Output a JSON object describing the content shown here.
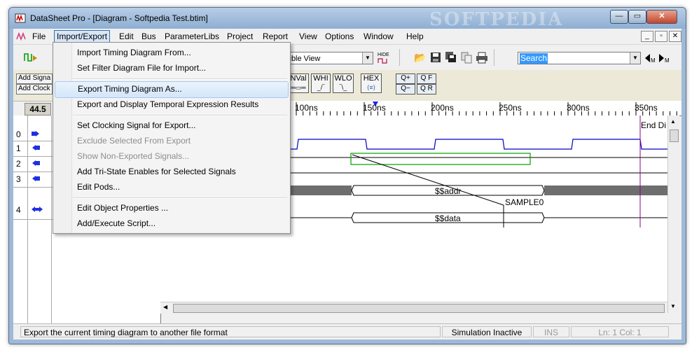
{
  "window": {
    "title": "DataSheet Pro - [Diagram - Softpedia Test.btim]",
    "watermark": "SOFTPEDIA",
    "controls": {
      "minimize": "—",
      "maximize": "▭",
      "close": "✕"
    }
  },
  "menubar": {
    "items": [
      "File",
      "Import/Export",
      "Edit",
      "Bus",
      "ParameterLibs",
      "Project",
      "Report",
      "View",
      "Options",
      "Window",
      "Help"
    ],
    "active_index": 1,
    "mdi_controls": {
      "minimize": "_",
      "restore": "▫",
      "close": "✕"
    }
  },
  "toolbar": {
    "view_combo_value": "sible View",
    "hide_label": "HIDE",
    "search_value": "Search"
  },
  "panel_buttons": {
    "add_signal": "Add Signa",
    "add_clock": "Add Clock",
    "nval": "NVal",
    "whi": "WHI",
    "wlo": "WLO",
    "hex": "HEX",
    "zoom_in_x": "Q+",
    "zoom_fit": "Q F",
    "zoom_out_x": "Q−",
    "zoom_reset": "Q R"
  },
  "time_readout": "44.5",
  "ruler": {
    "labels": [
      "100ns",
      "150ns",
      "200ns",
      "250ns",
      "300ns",
      "350ns"
    ]
  },
  "end_label": "End Di",
  "signals": [
    {
      "num": "0"
    },
    {
      "num": "1"
    },
    {
      "num": "2"
    },
    {
      "num": "3"
    },
    {
      "num": "4"
    }
  ],
  "bus_labels": {
    "addr": "$$addr",
    "data": "$$data",
    "sample": "SAMPLE0"
  },
  "menu": {
    "items": [
      {
        "label": "Import Timing Diagram From...",
        "state": "normal"
      },
      {
        "label": "Set Filter Diagram File for Import...",
        "state": "normal"
      },
      {
        "label": "Export Timing Diagram As...",
        "state": "highlighted"
      },
      {
        "label": "Export and Display Temporal Expression Results",
        "state": "normal"
      },
      {
        "label": "Set Clocking Signal for Export...",
        "state": "normal"
      },
      {
        "label": "Exclude Selected From Export",
        "state": "disabled"
      },
      {
        "label": "Show Non-Exported Signals...",
        "state": "disabled"
      },
      {
        "label": "Add Tri-State Enables for Selected Signals",
        "state": "normal"
      },
      {
        "label": "Edit Pods...",
        "state": "normal"
      },
      {
        "label": "Edit Object Properties ...",
        "state": "normal"
      },
      {
        "label": "Add/Execute Script...",
        "state": "normal"
      }
    ]
  },
  "status": {
    "message": "Export the current timing diagram to another file format",
    "simulation": "Simulation Inactive",
    "ins": "INS",
    "position": "Ln: 1  Col: 1"
  },
  "colors": {
    "clock_wave": "#0000c0",
    "highlight_wave": "#00a000",
    "bus_fill": "#6e6e6e",
    "cursor_line": "#8a008a",
    "marker": "#2020ff"
  }
}
